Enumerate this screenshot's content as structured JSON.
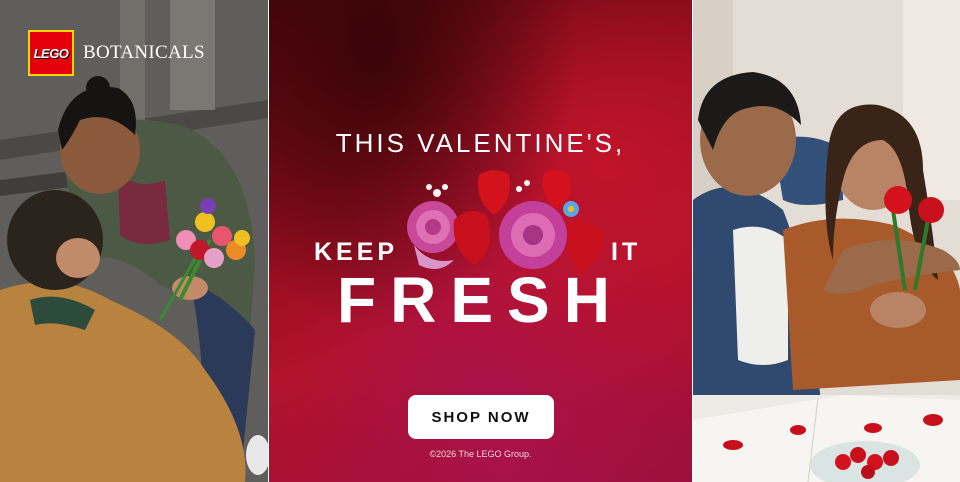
{
  "brand": {
    "logo_text": "LEGO",
    "name": "BOTANICALS"
  },
  "headline": {
    "line1": "THIS VALENTINE'S,",
    "keep": "KEEP",
    "it": "IT",
    "fresh": "FRESH"
  },
  "cta": {
    "label": "SHOP NOW"
  },
  "footer": {
    "copyright": "©2026 The LEGO Group."
  },
  "colors": {
    "lego_red": "#e3000b",
    "lego_yellow": "#ffd500",
    "center_bg": "#b3122c",
    "button_bg": "#ffffff"
  }
}
